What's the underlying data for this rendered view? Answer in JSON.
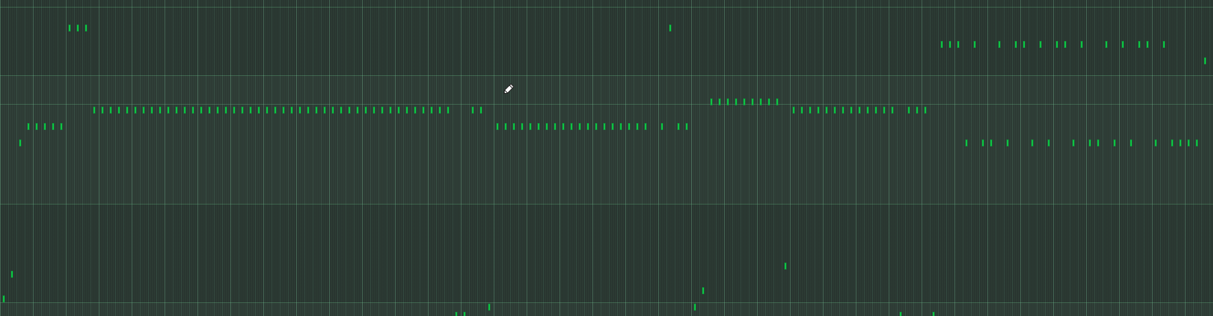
{
  "view": {
    "tool_cursor_icon": "pencil-icon",
    "background": "#2d3a34",
    "grid_line": "#6ec88c",
    "note_color": "#14d24a"
  },
  "lanes": 38,
  "notes": [
    {
      "t": 101,
      "r": 2
    },
    {
      "t": 113,
      "r": 2
    },
    {
      "t": 125,
      "r": 2
    },
    {
      "t": 977,
      "r": 2
    },
    {
      "t": 1373,
      "r": 4
    },
    {
      "t": 1385,
      "r": 4
    },
    {
      "t": 1397,
      "r": 4
    },
    {
      "t": 1421,
      "r": 4
    },
    {
      "t": 1457,
      "r": 4
    },
    {
      "t": 1481,
      "r": 4
    },
    {
      "t": 1493,
      "r": 4
    },
    {
      "t": 1517,
      "r": 4
    },
    {
      "t": 1541,
      "r": 4
    },
    {
      "t": 1553,
      "r": 4
    },
    {
      "t": 1577,
      "r": 4
    },
    {
      "t": 1613,
      "r": 4
    },
    {
      "t": 1637,
      "r": 4
    },
    {
      "t": 1661,
      "r": 4
    },
    {
      "t": 1673,
      "r": 4
    },
    {
      "t": 1697,
      "r": 4
    },
    {
      "t": 1757,
      "r": 6
    },
    {
      "t": 1037,
      "r": 11
    },
    {
      "t": 1049,
      "r": 11
    },
    {
      "t": 1061,
      "r": 11
    },
    {
      "t": 1073,
      "r": 11
    },
    {
      "t": 1085,
      "r": 11
    },
    {
      "t": 1097,
      "r": 11
    },
    {
      "t": 1109,
      "r": 11
    },
    {
      "t": 1121,
      "r": 11
    },
    {
      "t": 1133,
      "r": 11
    },
    {
      "t": 137,
      "r": 12
    },
    {
      "t": 149,
      "r": 12
    },
    {
      "t": 161,
      "r": 12
    },
    {
      "t": 173,
      "r": 12
    },
    {
      "t": 185,
      "r": 12
    },
    {
      "t": 197,
      "r": 12
    },
    {
      "t": 209,
      "r": 12
    },
    {
      "t": 221,
      "r": 12
    },
    {
      "t": 233,
      "r": 12
    },
    {
      "t": 245,
      "r": 12
    },
    {
      "t": 257,
      "r": 12
    },
    {
      "t": 269,
      "r": 12
    },
    {
      "t": 281,
      "r": 12
    },
    {
      "t": 293,
      "r": 12
    },
    {
      "t": 305,
      "r": 12
    },
    {
      "t": 317,
      "r": 12
    },
    {
      "t": 329,
      "r": 12
    },
    {
      "t": 341,
      "r": 12
    },
    {
      "t": 353,
      "r": 12
    },
    {
      "t": 365,
      "r": 12
    },
    {
      "t": 377,
      "r": 12
    },
    {
      "t": 389,
      "r": 12
    },
    {
      "t": 401,
      "r": 12
    },
    {
      "t": 413,
      "r": 12
    },
    {
      "t": 425,
      "r": 12
    },
    {
      "t": 437,
      "r": 12
    },
    {
      "t": 449,
      "r": 12
    },
    {
      "t": 461,
      "r": 12
    },
    {
      "t": 473,
      "r": 12
    },
    {
      "t": 485,
      "r": 12
    },
    {
      "t": 497,
      "r": 12
    },
    {
      "t": 509,
      "r": 12
    },
    {
      "t": 521,
      "r": 12
    },
    {
      "t": 533,
      "r": 12
    },
    {
      "t": 545,
      "r": 12
    },
    {
      "t": 557,
      "r": 12
    },
    {
      "t": 569,
      "r": 12
    },
    {
      "t": 581,
      "r": 12
    },
    {
      "t": 593,
      "r": 12
    },
    {
      "t": 605,
      "r": 12
    },
    {
      "t": 617,
      "r": 12
    },
    {
      "t": 629,
      "r": 12
    },
    {
      "t": 641,
      "r": 12
    },
    {
      "t": 653,
      "r": 12
    },
    {
      "t": 689,
      "r": 12
    },
    {
      "t": 701,
      "r": 12
    },
    {
      "t": 1157,
      "r": 12
    },
    {
      "t": 1169,
      "r": 12
    },
    {
      "t": 1181,
      "r": 12
    },
    {
      "t": 1193,
      "r": 12
    },
    {
      "t": 1205,
      "r": 12
    },
    {
      "t": 1217,
      "r": 12
    },
    {
      "t": 1229,
      "r": 12
    },
    {
      "t": 1241,
      "r": 12
    },
    {
      "t": 1253,
      "r": 12
    },
    {
      "t": 1265,
      "r": 12
    },
    {
      "t": 1277,
      "r": 12
    },
    {
      "t": 1289,
      "r": 12
    },
    {
      "t": 1301,
      "r": 12
    },
    {
      "t": 1325,
      "r": 12
    },
    {
      "t": 1337,
      "r": 12
    },
    {
      "t": 1349,
      "r": 12
    },
    {
      "t": 41,
      "r": 14
    },
    {
      "t": 53,
      "r": 14
    },
    {
      "t": 65,
      "r": 14
    },
    {
      "t": 77,
      "r": 14
    },
    {
      "t": 89,
      "r": 14
    },
    {
      "t": 725,
      "r": 14
    },
    {
      "t": 737,
      "r": 14
    },
    {
      "t": 749,
      "r": 14
    },
    {
      "t": 761,
      "r": 14
    },
    {
      "t": 773,
      "r": 14
    },
    {
      "t": 785,
      "r": 14
    },
    {
      "t": 797,
      "r": 14
    },
    {
      "t": 809,
      "r": 14
    },
    {
      "t": 821,
      "r": 14
    },
    {
      "t": 833,
      "r": 14
    },
    {
      "t": 845,
      "r": 14
    },
    {
      "t": 857,
      "r": 14
    },
    {
      "t": 869,
      "r": 14
    },
    {
      "t": 881,
      "r": 14
    },
    {
      "t": 893,
      "r": 14
    },
    {
      "t": 905,
      "r": 14
    },
    {
      "t": 917,
      "r": 14
    },
    {
      "t": 929,
      "r": 14
    },
    {
      "t": 941,
      "r": 14
    },
    {
      "t": 965,
      "r": 14
    },
    {
      "t": 989,
      "r": 14
    },
    {
      "t": 1001,
      "r": 14
    },
    {
      "t": 29,
      "r": 16
    },
    {
      "t": 1409,
      "r": 16
    },
    {
      "t": 1433,
      "r": 16
    },
    {
      "t": 1445,
      "r": 16
    },
    {
      "t": 1469,
      "r": 16
    },
    {
      "t": 1505,
      "r": 16
    },
    {
      "t": 1529,
      "r": 16
    },
    {
      "t": 1565,
      "r": 16
    },
    {
      "t": 1589,
      "r": 16
    },
    {
      "t": 1601,
      "r": 16
    },
    {
      "t": 1625,
      "r": 16
    },
    {
      "t": 1649,
      "r": 16
    },
    {
      "t": 1685,
      "r": 16
    },
    {
      "t": 1709,
      "r": 16
    },
    {
      "t": 1721,
      "r": 16
    },
    {
      "t": 1733,
      "r": 16
    },
    {
      "t": 1745,
      "r": 16
    },
    {
      "t": 1145,
      "r": 31
    },
    {
      "t": 17,
      "r": 32
    },
    {
      "t": 1025,
      "r": 34
    },
    {
      "t": 5,
      "r": 35
    },
    {
      "t": 713,
      "r": 36
    },
    {
      "t": 1013,
      "r": 36
    },
    {
      "t": 665,
      "r": 37
    },
    {
      "t": 677,
      "r": 37
    },
    {
      "t": 1313,
      "r": 37
    },
    {
      "t": 1361,
      "r": 37
    }
  ]
}
